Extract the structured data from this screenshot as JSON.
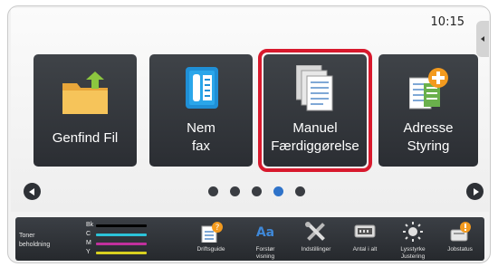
{
  "status": {
    "time": "10:15"
  },
  "tiles": [
    {
      "label_lines": [
        "Genfind Fil"
      ],
      "icon": "folder-retrieve-icon"
    },
    {
      "label_lines": [
        "Nem",
        "fax"
      ],
      "icon": "fax-icon"
    },
    {
      "label_lines": [
        "Manuel",
        "Færdiggørelse"
      ],
      "icon": "documents-finishing-icon",
      "selected": true
    },
    {
      "label_lines": [
        "Adresse",
        "Styring"
      ],
      "icon": "address-book-add-icon"
    }
  ],
  "pager": {
    "page_count": 5,
    "active_index": 3
  },
  "toner": {
    "label_lines": [
      "Toner",
      "beholdning"
    ],
    "levels": [
      {
        "name": "Bk",
        "color": "#000000"
      },
      {
        "name": "C",
        "color": "#2bc3d8"
      },
      {
        "name": "M",
        "color": "#c0309c"
      },
      {
        "name": "Y",
        "color": "#d8d020"
      }
    ]
  },
  "bottom_bar": [
    {
      "label_lines": [
        "Driftsguide"
      ],
      "icon": "operation-guide-icon"
    },
    {
      "label_lines": [
        "Forstør",
        "visning"
      ],
      "icon": "enlarge-display-icon"
    },
    {
      "label_lines": [
        "Indstillinger"
      ],
      "icon": "settings-tools-icon"
    },
    {
      "label_lines": [
        "Antal i alt"
      ],
      "icon": "total-count-icon"
    },
    {
      "label_lines": [
        "Lysstyrke",
        "Justering"
      ],
      "icon": "brightness-icon"
    },
    {
      "label_lines": [
        "Jobstatus"
      ],
      "icon": "job-status-icon"
    }
  ],
  "colors": {
    "tile_bg": "#2f3237",
    "highlight": "#d8192d",
    "active_dot": "#2f73c9",
    "accent_green": "#8cc63f",
    "accent_orange": "#f39a1e"
  }
}
